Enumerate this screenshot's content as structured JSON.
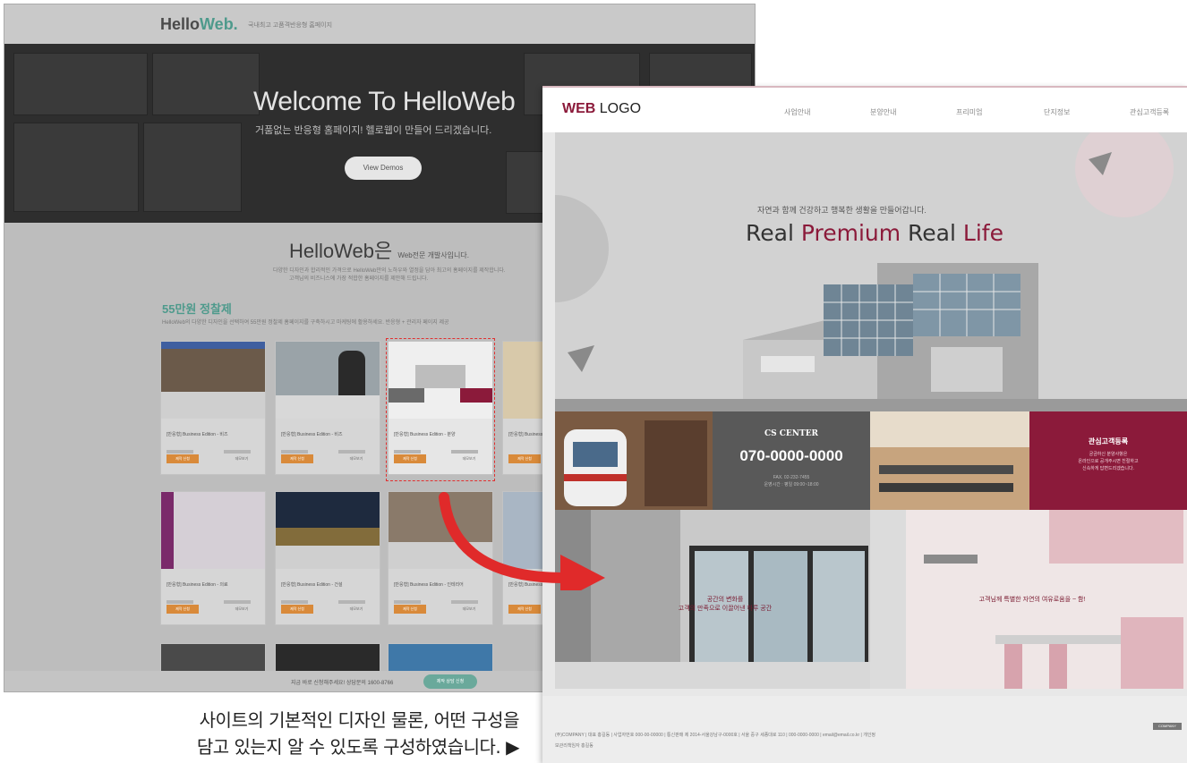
{
  "left_site": {
    "logo_main": "Hello",
    "logo_accent": "Web.",
    "logo_tagline": "국내최고 고품격반응형 홈페이지",
    "hero_title": "Welcome To HelloWeb",
    "hero_subtitle": "거품없는 반응형 홈페이지! 헬로웹이 만들어 드리겠습니다.",
    "hero_button": "View Demos",
    "mid_title": "HelloWeb은",
    "mid_title_small": "Web전문 개발사입니다.",
    "mid_desc_1": "다양한 디자인과 합리적인 가격으로 HelloWeb만의 노하우와 열정을 담아 최고의 홈페이지를 제작합니다.",
    "mid_desc_2": "고객님의 비즈니스에 가장 적합한 홈페이지를 제안해 드립니다.",
    "section_title": "55만원 정찰제",
    "section_desc": "HelloWeb의 다양한 디자인을 선택하여 55만원 정찰제 홈페이지를 구축하시고 마케팅에 활용하세요. 반응형 + 관리자 페이지 제공",
    "cards": [
      {
        "name": "[반응형] Business Edition - 비즈",
        "btn_a": "제작 신청",
        "btn_b": "데모보기"
      },
      {
        "name": "[반응형] Business Edition - 비즈",
        "btn_a": "제작 신청",
        "btn_b": "데모보기"
      },
      {
        "name": "[반응형] Business Edition - 분양",
        "btn_a": "제작 신청",
        "btn_b": "데모보기"
      },
      {
        "name": "[반응형] Business",
        "btn_a": "제작 신청",
        "btn_b": "데모"
      },
      {
        "name": "[반응형] Business Edition - 의료",
        "btn_a": "제작 신청",
        "btn_b": "데모보기"
      },
      {
        "name": "[반응형] Business Edition - 건설",
        "btn_a": "제작 신청",
        "btn_b": "데모보기"
      },
      {
        "name": "[반응형] Business Edition - 인테리어",
        "btn_a": "제작 신청",
        "btn_b": "데모보기"
      },
      {
        "name": "[반응형] Business",
        "btn_a": "제작 신청",
        "btn_b": "데모"
      }
    ],
    "bottom_text": "지금 바로 신청해주세요! 상담문의 1600-8766",
    "bottom_button": "제작 상담 신청"
  },
  "caption": {
    "line1": "사이트의 기본적인 디자인 물론, 어떤 구성을",
    "line2": "담고 있는지 알 수 있도록 구성하였습니다. ▶"
  },
  "right_site": {
    "logo_bold": "WEB",
    "logo_rest": " LOGO",
    "nav": [
      "사업안내",
      "분양안내",
      "프리미엄",
      "단지정보",
      "관심고객등록"
    ],
    "hero_sub": "자연과 함께 건강하고 행복한 생활을 만들어갑니다.",
    "hero_title_1": "Real ",
    "hero_title_acc_1": "Premium",
    "hero_title_2": " Real ",
    "hero_title_acc_2": "Life",
    "cs_title": "CS CENTER",
    "cs_phone": "070-0000-0000",
    "cs_fax": "FAX. 02-232-7455",
    "cs_hours": "운영시간 : 평일 09:00~18:00",
    "reg_title": "관심고객등록",
    "reg_desc_1": "궁금하신 분양사항은",
    "reg_desc_2": "온라인으로 공개주시면 친절하고",
    "reg_desc_3": "신속하게 답변드리겠습니다.",
    "pic1_text_1": "공간의 변화를",
    "pic1_text_2": "고객의 만족으로 이끌어낸 하루 공간",
    "pic2_text": "고객님께 특별한 자연의 여유로움을 ~ 함!",
    "footer_1": "(주)COMPANY | 대표 홍길동 | 사업자번호 000-00-00000 | 통신판매 제 2014-서울강남구-0000호 | 서울 중구 세종대로 110 | 000-0000-0000 | email@email.co.kr | 개인정",
    "footer_2": "보관리책임자 홍길동",
    "footer_badge": "COMPANY"
  },
  "colors": {
    "brand_accent": "#8b1a3a",
    "left_accent": "#4e9a8c",
    "arrow": "#e02a2a",
    "dashed_highlight": "#e03030"
  }
}
